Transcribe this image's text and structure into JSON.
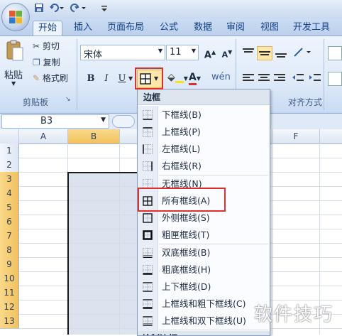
{
  "title_bar": {
    "quick_access": [
      "save-icon",
      "undo-icon",
      "redo-icon"
    ]
  },
  "tabs": [
    "开始",
    "插入",
    "页面布局",
    "公式",
    "数据",
    "审阅",
    "视图",
    "开发工具"
  ],
  "active_tab": "开始",
  "clipboard": {
    "paste": "粘贴",
    "cut": "剪切",
    "copy": "复制",
    "format_painter": "格式刷",
    "group_label": "剪贴板"
  },
  "font": {
    "name": "宋体",
    "size": "11",
    "bold": "B",
    "italic": "I",
    "underline": "U"
  },
  "alignment": {
    "group_label": "对齐方式"
  },
  "formula_bar": {
    "cell_ref": "B3"
  },
  "columns": [
    "A",
    "B",
    "F"
  ],
  "rows": [
    "1",
    "2",
    "3",
    "4",
    "5",
    "6",
    "7",
    "8",
    "9",
    "10",
    "11",
    "12",
    "13"
  ],
  "border_menu": {
    "title": "边框",
    "items": [
      "下框线(B)",
      "上框线(P)",
      "左框线(L)",
      "右框线(R)",
      "无框线(N)",
      "所有框线(A)",
      "外侧框线(S)",
      "粗匣框线(T)",
      "双底框线(B)",
      "粗底框线(H)",
      "上下框线(D)",
      "上框线和粗下框线(C)",
      "上框线和双下框线(U)",
      "绘制边框"
    ]
  },
  "watermark": "软件技巧",
  "colors": {
    "highlight": "#e0302c",
    "selection": "#dde3ee",
    "ribbon_accent": "#15428b"
  }
}
